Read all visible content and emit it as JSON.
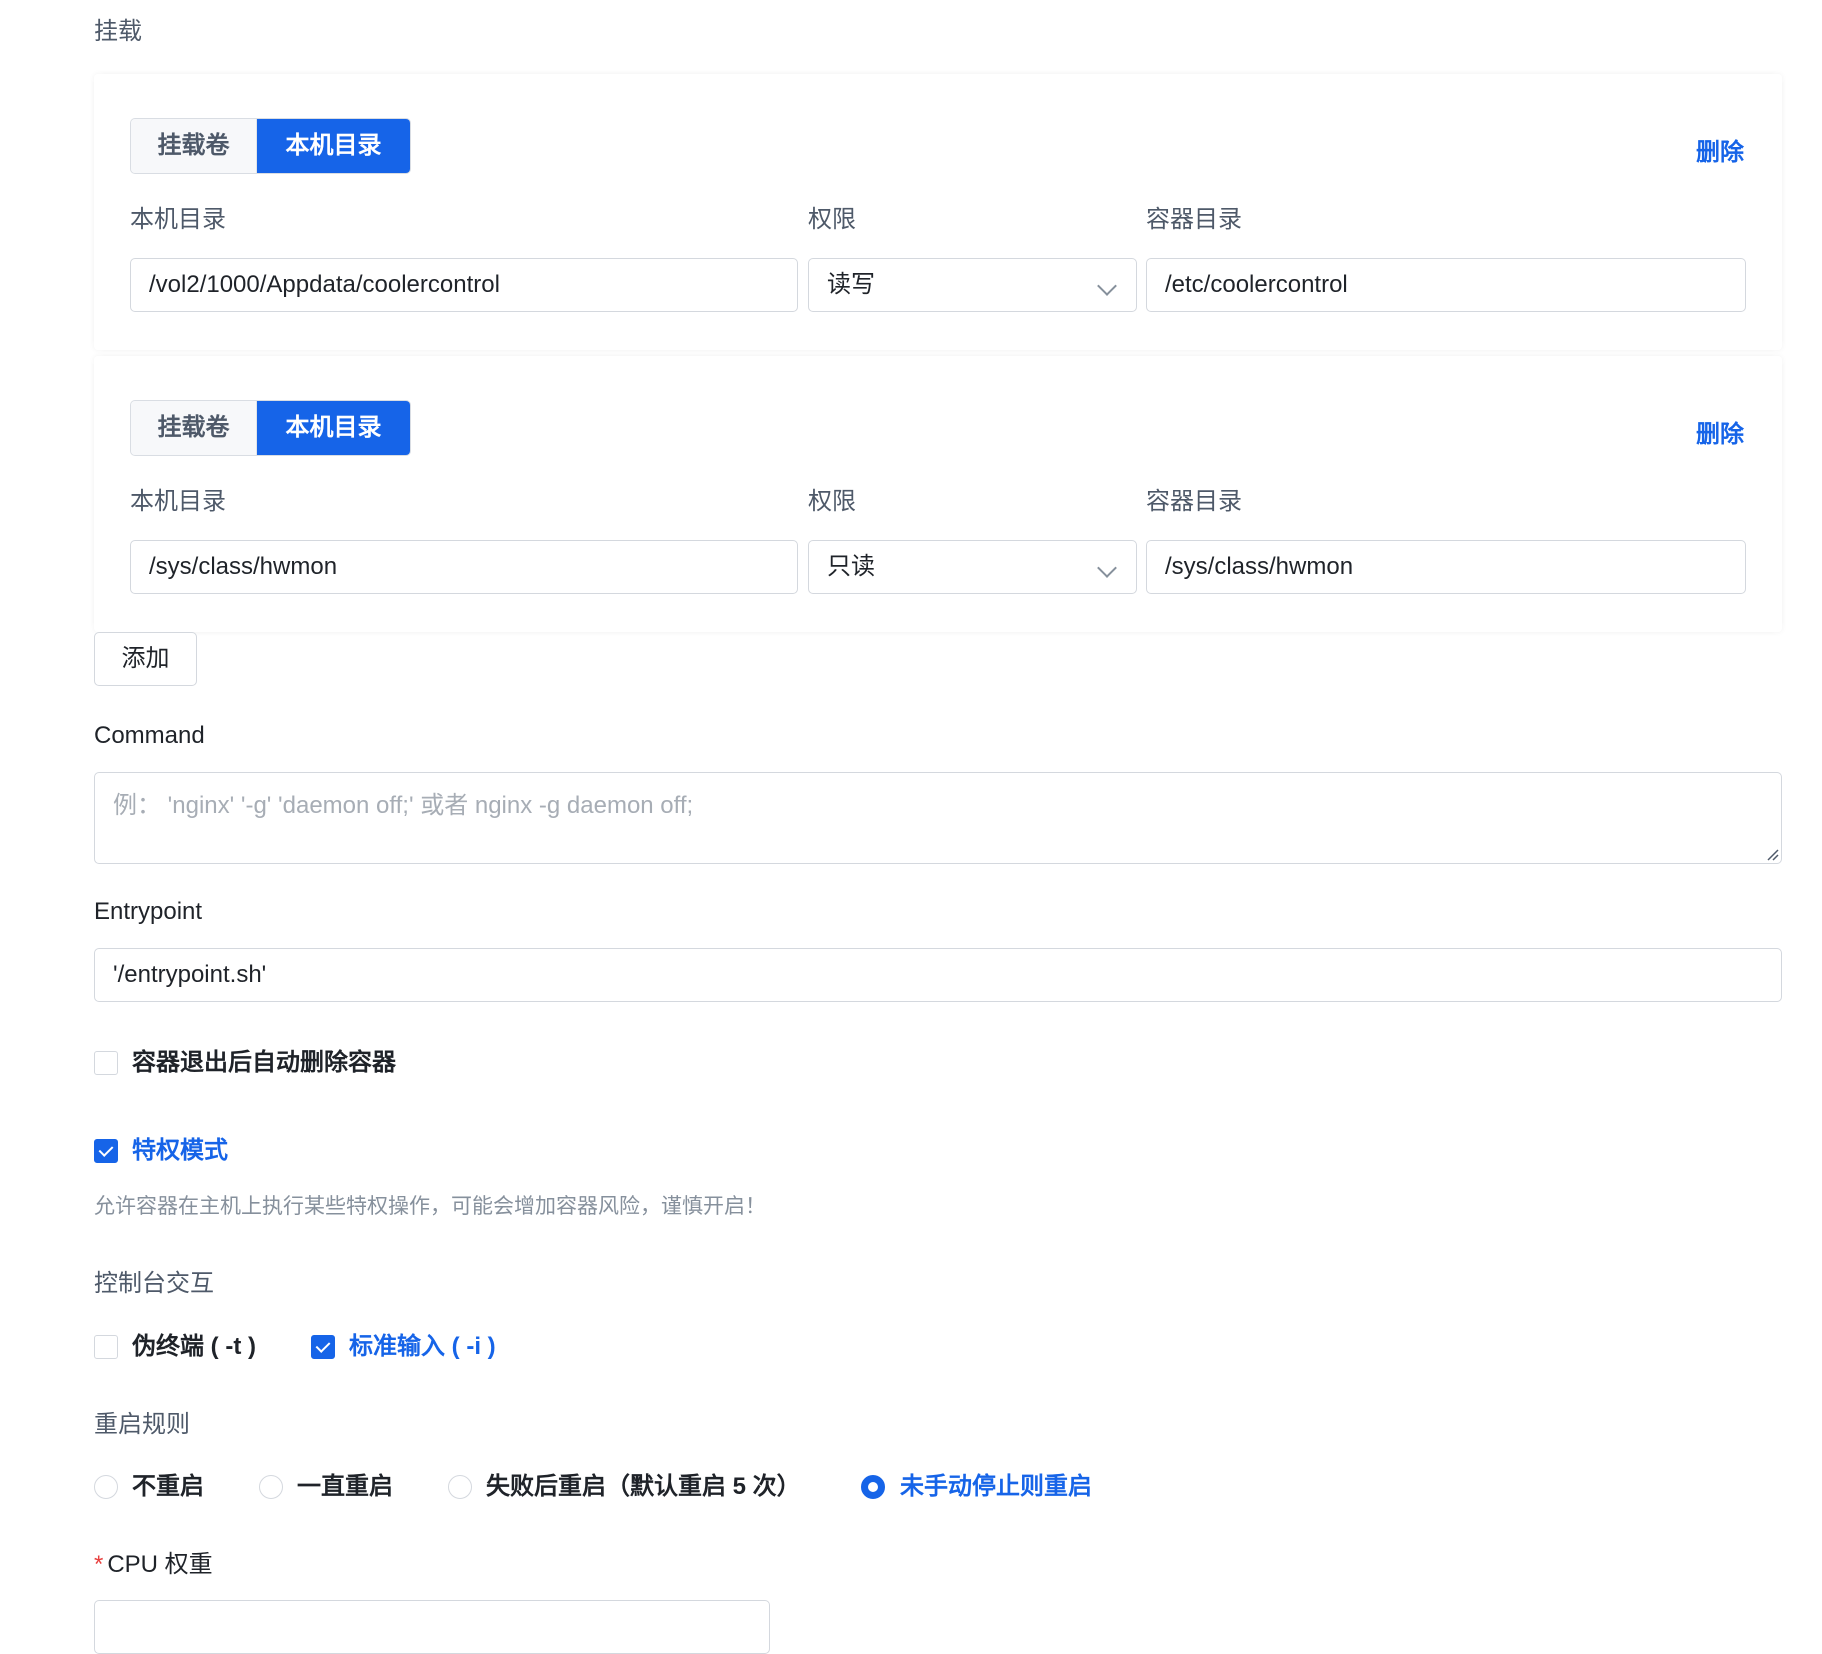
{
  "mount": {
    "section_label": "挂载",
    "cards": [
      {
        "tab_volume": "挂载卷",
        "tab_host_dir": "本机目录",
        "delete_label": "删除",
        "host_dir_label": "本机目录",
        "perm_label": "权限",
        "container_dir_label": "容器目录",
        "host_dir_value": "/vol2/1000/Appdata/coolercontrol",
        "perm_value": "读写",
        "container_dir_value": "/etc/coolercontrol"
      },
      {
        "tab_volume": "挂载卷",
        "tab_host_dir": "本机目录",
        "delete_label": "删除",
        "host_dir_label": "本机目录",
        "perm_label": "权限",
        "container_dir_label": "容器目录",
        "host_dir_value": "/sys/class/hwmon",
        "perm_value": "只读",
        "container_dir_value": "/sys/class/hwmon"
      }
    ],
    "add_label": "添加"
  },
  "command": {
    "label": "Command",
    "placeholder": "例：  'nginx' '-g' 'daemon off;' 或者 nginx -g daemon off;"
  },
  "entrypoint": {
    "label": "Entrypoint",
    "value": "'/entrypoint.sh'"
  },
  "options": {
    "auto_remove_label": "容器退出后自动删除容器",
    "auto_remove_checked": false,
    "privileged_label": "特权模式",
    "privileged_checked": true,
    "privileged_hint": "允许容器在主机上执行某些特权操作，可能会增加容器风险，谨慎开启！"
  },
  "console": {
    "label": "控制台交互",
    "tty_label": "伪终端 ( -t )",
    "tty_checked": false,
    "stdin_label": "标准输入 ( -i )",
    "stdin_checked": true
  },
  "restart": {
    "label": "重启规则",
    "options": [
      "不重启",
      "一直重启",
      "失败后重启（默认重启 5 次）",
      "未手动停止则重启"
    ],
    "selected_index": 3
  },
  "cpu": {
    "required_mark": "*",
    "label": "CPU 权重"
  },
  "colors": {
    "accent": "#1664e8",
    "text": "#1f2329",
    "muted": "#4e5969",
    "hint": "#86909c",
    "border": "#d4d8de",
    "required": "#e8403f"
  }
}
